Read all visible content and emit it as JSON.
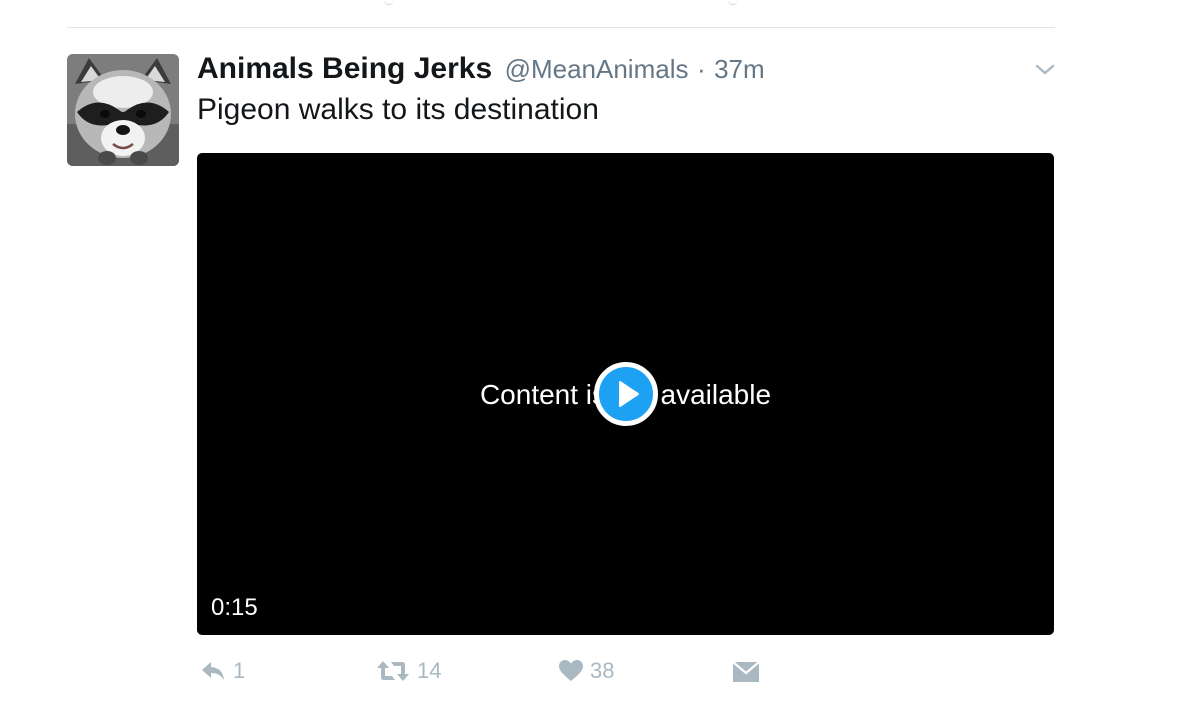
{
  "tweet": {
    "display_name": "Animals Being Jerks",
    "handle": "@MeanAnimals",
    "separator": "·",
    "time": "37m",
    "text": "Pigeon walks to its destination"
  },
  "media": {
    "status_text": "Content is not available",
    "duration": "0:15",
    "play_icon": "play-icon"
  },
  "actions": {
    "reply_count": "1",
    "retweet_count": "14",
    "like_count": "38",
    "reply_icon": "reply-icon",
    "retweet_icon": "retweet-icon",
    "like_icon": "heart-icon",
    "dm_icon": "direct-message-icon"
  },
  "colors": {
    "accent": "#1da1f2",
    "text_primary": "#14171a",
    "text_secondary": "#657786",
    "action_gray": "#aab8c2",
    "media_background": "#000000"
  }
}
